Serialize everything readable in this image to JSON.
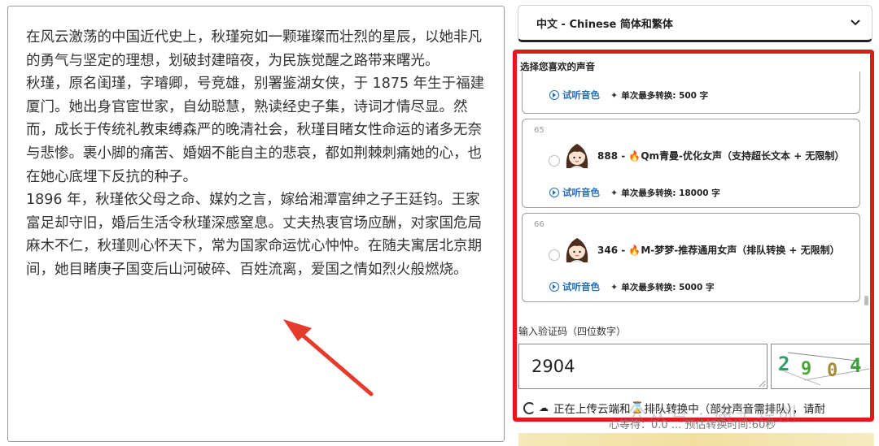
{
  "article": {
    "paragraphs": [
      "在风云激荡的中国近代史上，秋瑾宛如一颗璀璨而壮烈的星辰，以她非凡的勇气与坚定的理想，划破封建暗夜，为民族觉醒之路带来曙光。",
      "秋瑾，原名闺瑾，字璿卿，号竞雄，别署鉴湖女侠，于 1875 年生于福建厦门。她出身官宦世家，自幼聪慧，熟读经史子集，诗词才情尽显。然而，成长于传统礼教束缚森严的晚清社会，秋瑾目睹女性命运的诸多无奈与悲惨。裹小脚的痛苦、婚姻不能自主的悲哀，都如荆棘刺痛她的心，也在她心底埋下反抗的种子。",
      "1896 年，秋瑾依父母之命、媒妁之言，嫁给湘潭富绅之子王廷钧。王家富足却守旧，婚后生活令秋瑾深感窒息。丈夫热衷官场应酬，对家国危局麻木不仁，秋瑾则心怀天下，常为国家命运忧心忡忡。在随夫寓居北京期间，她目睹庚子国变后山河破碎、百姓流离，爱国之情如烈火般燃烧。"
    ]
  },
  "language_select": {
    "value": "中文 - Chinese 简体和繁体"
  },
  "voice_panel": {
    "title": "选择您喜欢的声音",
    "listen_label": "试听音色",
    "cards": [
      {
        "num": "",
        "name": "",
        "limit": "单次最多转换: 500 字"
      },
      {
        "num": "65",
        "name": "888 - 🔥Qm青曼-优化女声（支持超长文本 + 无限制）",
        "limit": "单次最多转换: 18000 字"
      },
      {
        "num": "66",
        "name": "346 - 🔥M-梦梦-推荐通用女声（排队转换 + 无限制）",
        "limit": "单次最多转换: 5000 字"
      }
    ]
  },
  "captcha": {
    "label": "输入验证码（四位数字）",
    "value": "2904",
    "image_chars": [
      "2",
      "9",
      "0",
      "4"
    ]
  },
  "status": {
    "uploading": "正在上传云端和",
    "queue": "排队转换中（部分声音需排队），请耐",
    "waiting": "心等待：0.0 ... 预估转换时间:60秒"
  },
  "watermark": "公众号 · 康宁轻创",
  "colors": {
    "highlight_border": "#e0191b",
    "link_blue": "#1f6fbf",
    "arrow_red": "#e53b2c"
  }
}
